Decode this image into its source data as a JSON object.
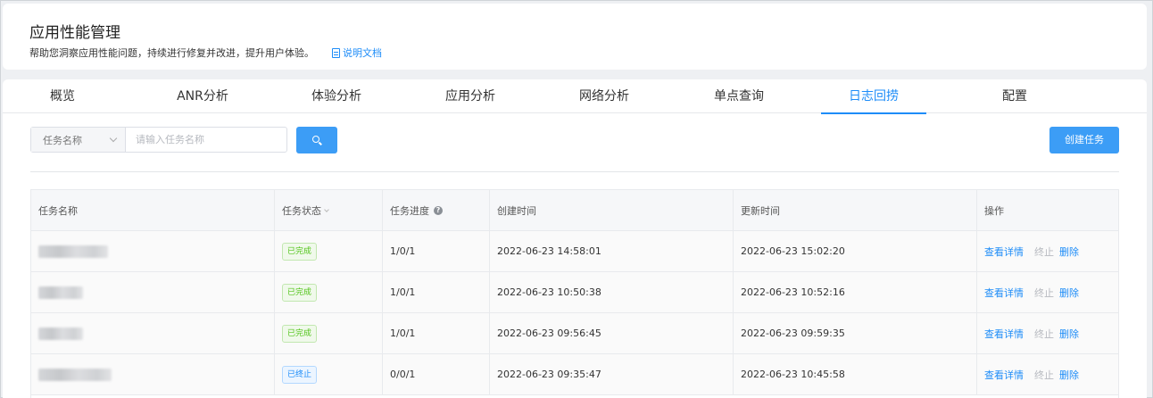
{
  "header": {
    "title": "应用性能管理",
    "subtitle": "帮助您洞察应用性能问题，持续进行修复并改进，提升用户体验。",
    "doc_link": "说明文档"
  },
  "tabs": [
    {
      "label": "概览"
    },
    {
      "label": "ANR分析"
    },
    {
      "label": "体验分析"
    },
    {
      "label": "应用分析"
    },
    {
      "label": "网络分析"
    },
    {
      "label": "单点查询"
    },
    {
      "label": "日志回捞",
      "active": true
    },
    {
      "label": "配置"
    }
  ],
  "search": {
    "filter_label": "任务名称",
    "placeholder": "请输入任务名称"
  },
  "create_button": "创建任务",
  "table": {
    "columns": [
      "任务名称",
      "任务状态",
      "任务进度",
      "创建时间",
      "更新时间",
      "操作"
    ],
    "rows": [
      {
        "status": "已完成",
        "progress": "1/0/1",
        "created": "2022-06-23 14:58:01",
        "updated": "2022-06-23 15:02:20"
      },
      {
        "status": "已完成",
        "progress": "1/0/1",
        "created": "2022-06-23 10:50:38",
        "updated": "2022-06-23 10:52:16"
      },
      {
        "status": "已完成",
        "progress": "1/0/1",
        "created": "2022-06-23 09:56:45",
        "updated": "2022-06-23 09:59:35"
      },
      {
        "status": "已终止",
        "progress": "0/0/1",
        "created": "2022-06-23 09:35:47",
        "updated": "2022-06-23 10:45:58"
      }
    ],
    "actions": {
      "detail": "查看详情",
      "terminate": "终止",
      "delete": "删除"
    }
  },
  "colors": {
    "accent": "#1d8cf8",
    "button": "#3c9df6",
    "success": "#52c41a"
  }
}
